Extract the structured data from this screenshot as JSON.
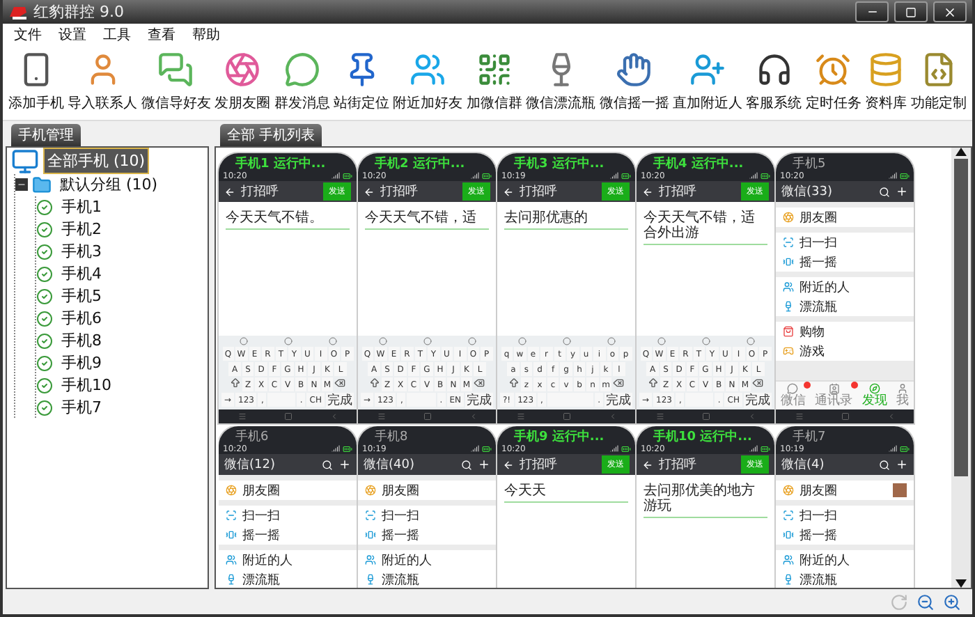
{
  "window": {
    "title": "红豹群控 9.0"
  },
  "menu": [
    "文件",
    "设置",
    "工具",
    "查看",
    "帮助"
  ],
  "toolbar": [
    "添加手机",
    "导入联系人",
    "微信导好友",
    "发朋友圈",
    "群发消息",
    "站街定位",
    "附近加好友",
    "加微信群",
    "微信漂流瓶",
    "微信摇一摇",
    "直加附近人",
    "客服系统",
    "定时任务",
    "资料库",
    "功能定制"
  ],
  "left_panel": {
    "title": "手机管理",
    "tree": [
      {
        "label": "全部手机 (10)",
        "selected": true,
        "children": [
          {
            "label": "默认分组 (10)",
            "selected": false,
            "expanded": true,
            "children": [
              {
                "label": "手机1",
                "selected": false
              },
              {
                "label": "手机2",
                "selected": false
              },
              {
                "label": "手机3",
                "selected": false
              },
              {
                "label": "手机4",
                "selected": false
              },
              {
                "label": "手机5",
                "selected": false
              },
              {
                "label": "手机6",
                "selected": false
              },
              {
                "label": "手机8",
                "selected": false
              },
              {
                "label": "手机9",
                "selected": false
              },
              {
                "label": "手机10",
                "selected": false
              },
              {
                "label": "手机7",
                "selected": false
              }
            ]
          }
        ]
      }
    ]
  },
  "right_panel": {
    "title": "全部 手机列表",
    "phones": [
      {
        "label": "手机1 运行中...",
        "running": true,
        "time": "10:20",
        "kind": "chat",
        "title": "打招呼",
        "send": "发送",
        "value": "今天天气不错。",
        "keys": [
          [
            "Q",
            "W",
            "E",
            "R",
            "T",
            "Y",
            "U",
            "I",
            "O",
            "P"
          ],
          [
            "A",
            "S",
            "D",
            "F",
            "G",
            "H",
            "J",
            "K",
            "L"
          ],
          [
            "Z",
            "X",
            "C",
            "V",
            "B",
            "N",
            "M"
          ],
          [
            "→",
            "123",
            ",",
            ".",
            "CH",
            "完成"
          ]
        ]
      },
      {
        "label": "手机2 运行中...",
        "running": true,
        "time": "10:20",
        "kind": "chat",
        "title": "打招呼",
        "send": "发送",
        "value": "今天天气不错，适",
        "keys": [
          [
            "Q",
            "W",
            "E",
            "R",
            "T",
            "Y",
            "U",
            "I",
            "O",
            "P"
          ],
          [
            "A",
            "S",
            "D",
            "F",
            "G",
            "H",
            "J",
            "K",
            "L"
          ],
          [
            "Z",
            "X",
            "C",
            "V",
            "B",
            "N",
            "M"
          ],
          [
            "→",
            "123",
            ",",
            ".",
            "EN",
            "完成"
          ]
        ]
      },
      {
        "label": "手机3 运行中...",
        "running": true,
        "time": "10:19",
        "kind": "chat",
        "title": "打招呼",
        "send": "发送",
        "value": "去问那优惠的",
        "keys": [
          [
            "q",
            "w",
            "e",
            "r",
            "t",
            "y",
            "u",
            "i",
            "o",
            "p"
          ],
          [
            "a",
            "s",
            "d",
            "f",
            "g",
            "h",
            "j",
            "k",
            "l"
          ],
          [
            "z",
            "x",
            "c",
            "v",
            "b",
            "n",
            "m"
          ],
          [
            "?!",
            "123",
            ",",
            ".",
            "完成"
          ]
        ]
      },
      {
        "label": "手机4 运行中...",
        "running": true,
        "time": "10:20",
        "kind": "chat",
        "title": "打招呼",
        "send": "发送",
        "value": "今天天气不错，适合外出游",
        "keys": [
          [
            "Q",
            "W",
            "E",
            "R",
            "T",
            "Y",
            "U",
            "I",
            "O",
            "P"
          ],
          [
            "A",
            "S",
            "D",
            "F",
            "G",
            "H",
            "J",
            "K",
            "L"
          ],
          [
            "Z",
            "X",
            "C",
            "V",
            "B",
            "N",
            "M"
          ],
          [
            "→",
            "123",
            ",",
            ".",
            "CH",
            "完成"
          ]
        ]
      },
      {
        "label": "手机5",
        "running": false,
        "time": "10:20",
        "kind": "wechat",
        "title": "微信(33)",
        "groups": [
          [
            {
              "label": "朋友圈"
            }
          ],
          [
            {
              "label": "扫一扫"
            },
            {
              "label": "摇一摇"
            }
          ],
          [
            {
              "label": "附近的人"
            },
            {
              "label": "漂流瓶"
            }
          ],
          [
            {
              "label": "购物"
            },
            {
              "label": "游戏"
            }
          ]
        ],
        "tabs": [
          {
            "label": "微信",
            "selected": false,
            "badge": true
          },
          {
            "label": "通讯录",
            "selected": false,
            "badge": true
          },
          {
            "label": "发现",
            "selected": true,
            "badge": false
          },
          {
            "label": "我",
            "selected": false,
            "badge": false
          }
        ]
      },
      {
        "label": "手机6",
        "running": false,
        "time": "10:20",
        "kind": "wechat",
        "title": "微信(12)",
        "groups": [
          [
            {
              "label": "朋友圈"
            }
          ],
          [
            {
              "label": "扫一扫"
            },
            {
              "label": "摇一摇"
            }
          ],
          [
            {
              "label": "附近的人"
            },
            {
              "label": "漂流瓶"
            }
          ]
        ]
      },
      {
        "label": "手机8",
        "running": false,
        "time": "10:19",
        "kind": "wechat",
        "title": "微信(40)",
        "groups": [
          [
            {
              "label": "朋友圈"
            }
          ],
          [
            {
              "label": "扫一扫"
            },
            {
              "label": "摇一摇"
            }
          ],
          [
            {
              "label": "附近的人"
            },
            {
              "label": "漂流瓶"
            }
          ]
        ]
      },
      {
        "label": "手机9 运行中...",
        "running": true,
        "time": "10:20",
        "kind": "chat",
        "title": "打招呼",
        "send": "发送",
        "value": "今天天"
      },
      {
        "label": "手机10 运行中...",
        "running": true,
        "time": "10:20",
        "kind": "chat",
        "title": "打招呼",
        "send": "发送",
        "value": "去问那优美的地方游玩"
      },
      {
        "label": "手机7",
        "running": false,
        "time": "10:19",
        "kind": "wechat",
        "title": "微信(4)",
        "groups": [
          [
            {
              "label": "朋友圈",
              "photo": true
            }
          ],
          [
            {
              "label": "扫一扫"
            },
            {
              "label": "摇一摇"
            }
          ],
          [
            {
              "label": "附近的人"
            },
            {
              "label": "漂流瓶"
            }
          ]
        ]
      }
    ]
  }
}
